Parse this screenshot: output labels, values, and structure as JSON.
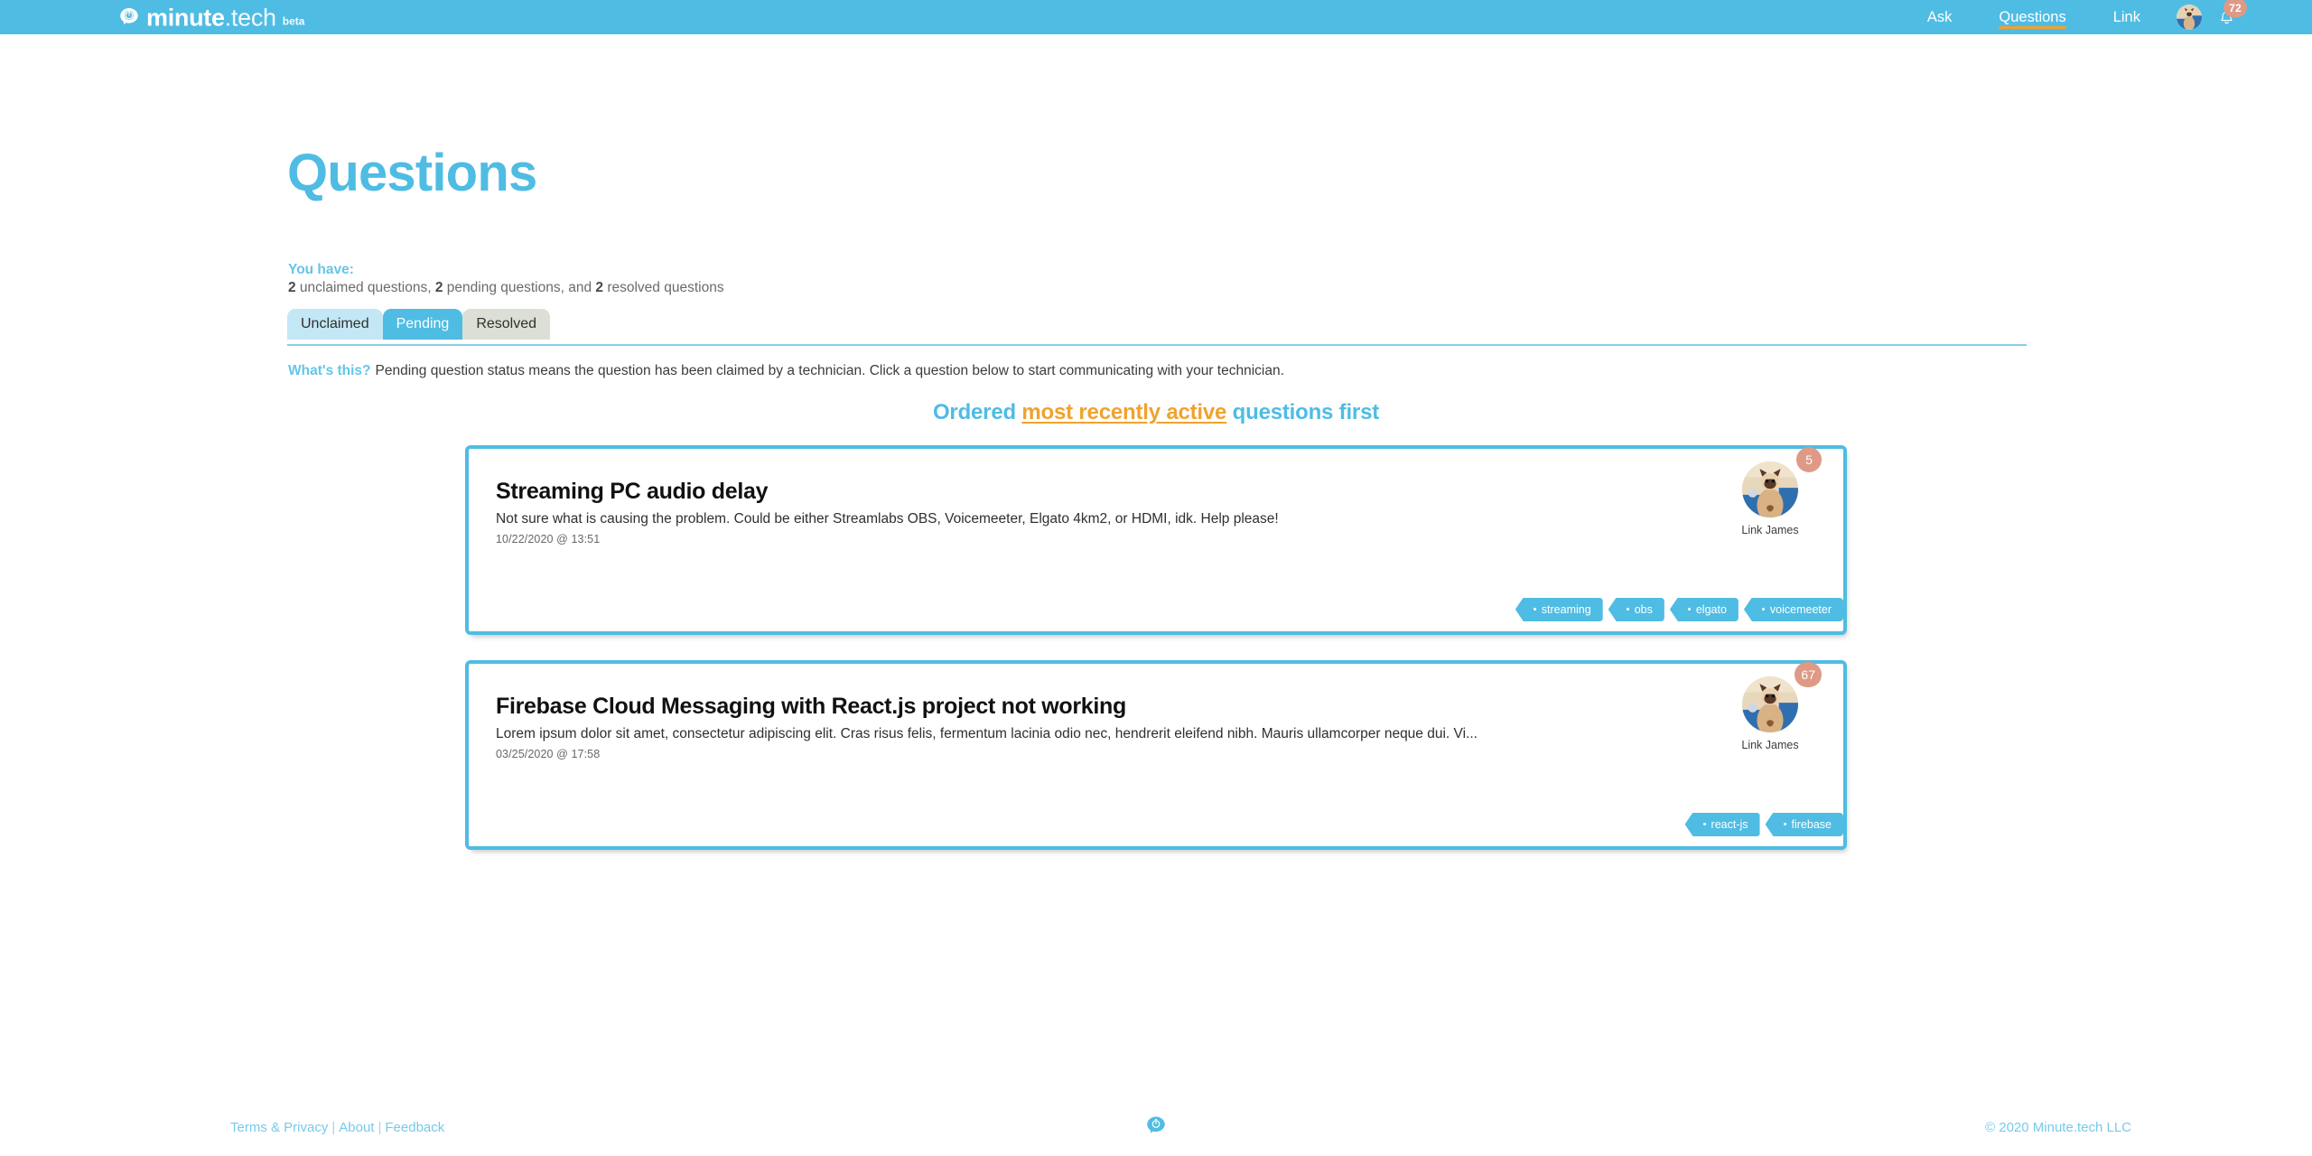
{
  "header": {
    "brand_bold": "minute",
    "brand_light": ".tech",
    "brand_beta": "beta",
    "logo_icon": "brain-stopwatch-icon",
    "nav": [
      {
        "label": "Ask",
        "active": false
      },
      {
        "label": "Questions",
        "active": true
      },
      {
        "label": "Link",
        "active": false
      }
    ],
    "avatar_icon": "user-avatar",
    "bell_icon": "bell-icon",
    "bell_badge": "72",
    "bar_color": "#4fbce3",
    "accent_color": "#f0a22e",
    "badge_color": "#de9a86"
  },
  "main": {
    "title": "Questions",
    "you_have_label": "You have:",
    "stats": {
      "unclaimed_count": "2",
      "unclaimed_text": " unclaimed questions, ",
      "pending_count": "2",
      "pending_text": " pending questions, and ",
      "resolved_count": "2",
      "resolved_text": " resolved questions"
    },
    "tabs": [
      {
        "label": "Unclaimed",
        "state": "unclaimed"
      },
      {
        "label": "Pending",
        "state": "pending"
      },
      {
        "label": "Resolved",
        "state": "resolved"
      }
    ],
    "whats_this_label": "What's this?",
    "whats_this_text": "Pending question status means the question has been claimed by a technician. Click a question below to start communicating with your technician.",
    "ordered": {
      "prefix": "Ordered ",
      "highlight": "most recently active",
      "suffix": " questions first"
    }
  },
  "questions": [
    {
      "title": "Streaming PC audio delay",
      "description": "Not sure what is causing the problem. Could be either Streamlabs OBS, Voicemeeter, Elgato 4km2, or HDMI, idk. Help please!",
      "date": "10/22/2020 @ 13:51",
      "user_name": "Link James",
      "badge": "5",
      "tags": [
        "streaming",
        "obs",
        "elgato",
        "voicemeeter"
      ]
    },
    {
      "title": "Firebase Cloud Messaging with React.js project not working",
      "description": "Lorem ipsum dolor sit amet, consectetur adipiscing elit. Cras risus felis, fermentum lacinia odio nec, hendrerit eleifend nibh. Mauris ullamcorper neque dui. Vi...",
      "date": "03/25/2020 @ 17:58",
      "user_name": "Link James",
      "badge": "67",
      "tags": [
        "react-js",
        "firebase"
      ]
    }
  ],
  "footer": {
    "terms": "Terms & Privacy",
    "sep1": "|",
    "about": "About",
    "sep2": "|",
    "feedback": "Feedback",
    "logo_icon": "brain-stopwatch-icon",
    "copyright": "© 2020 Minute.tech LLC"
  }
}
